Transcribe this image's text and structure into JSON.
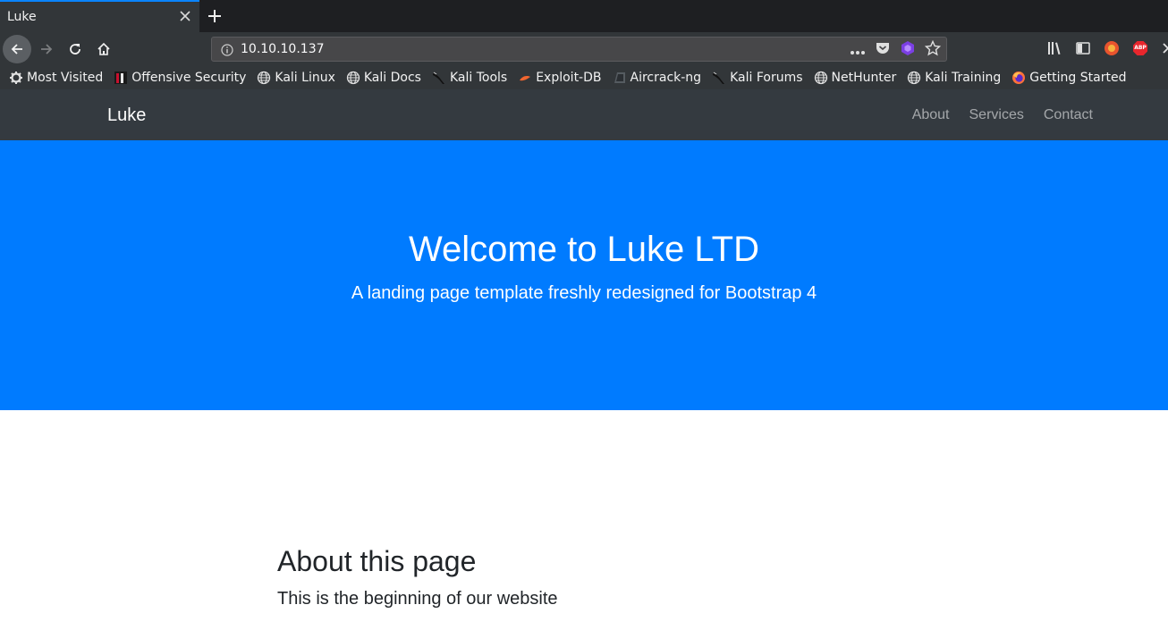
{
  "browser": {
    "tab_title": "Luke",
    "url": "10.10.10.137",
    "bookmarks": [
      {
        "label": "Most Visited",
        "icon": "gear-icon"
      },
      {
        "label": "Offensive Security",
        "icon": "offsec-icon"
      },
      {
        "label": "Kali Linux",
        "icon": "globe-icon"
      },
      {
        "label": "Kali Docs",
        "icon": "globe-icon"
      },
      {
        "label": "Kali Tools",
        "icon": "kali-dragon-icon"
      },
      {
        "label": "Exploit-DB",
        "icon": "exploitdb-icon"
      },
      {
        "label": "Aircrack-ng",
        "icon": "aircrack-icon"
      },
      {
        "label": "Kali Forums",
        "icon": "kali-dragon-icon"
      },
      {
        "label": "NetHunter",
        "icon": "globe-icon"
      },
      {
        "label": "Kali Training",
        "icon": "globe-icon"
      },
      {
        "label": "Getting Started",
        "icon": "firefox-icon"
      }
    ],
    "extension_badge": "ABP"
  },
  "site": {
    "brand": "Luke",
    "nav": [
      "About",
      "Services",
      "Contact"
    ],
    "hero": {
      "title": "Welcome to Luke LTD",
      "subtitle": "A landing page template freshly redesigned for Bootstrap 4"
    },
    "about": {
      "heading": "About this page",
      "text": "This is the beginning of our website"
    }
  },
  "colors": {
    "hero_bg": "#007bff",
    "site_nav_bg": "#343a40",
    "browser_chrome": "#323639",
    "tab_accent": "#0a84ff"
  }
}
